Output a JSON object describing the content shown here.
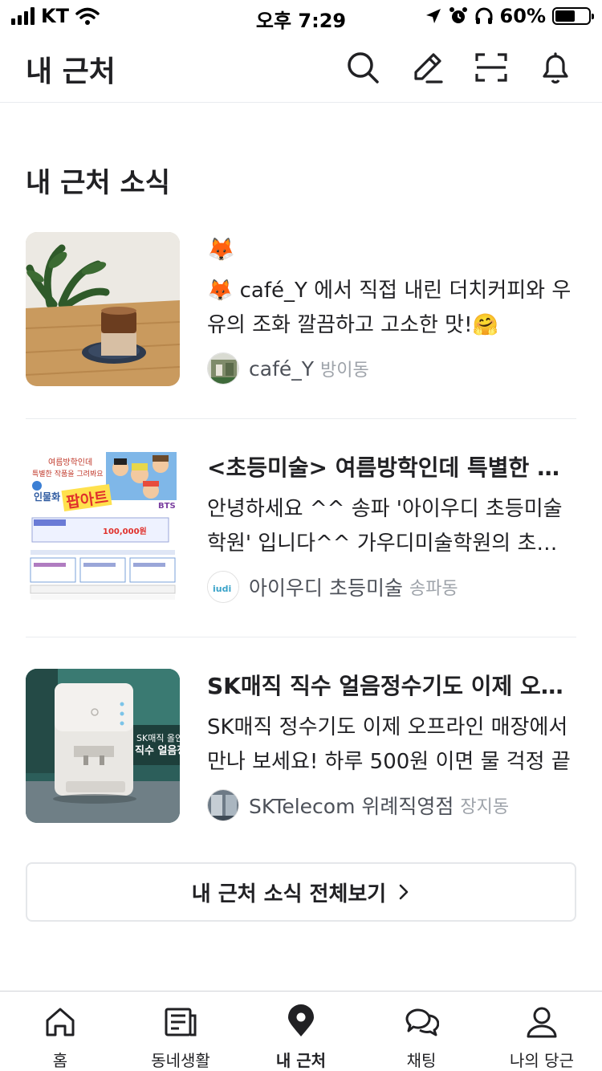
{
  "status_bar": {
    "carrier": "KT",
    "time": "오후 7:29",
    "battery": "60%",
    "battery_level": 0.6
  },
  "header": {
    "title": "내 근처",
    "icons": [
      "search-icon",
      "pencil-icon",
      "scan-icon",
      "bell-icon"
    ]
  },
  "section": {
    "title": "내 근처 소식"
  },
  "feed": [
    {
      "title": "🦊",
      "description": "🦊 café_Y 에서 직접 내린 더치커피와 우유의 조화 깔끔하고 고소한 맛!🤗",
      "business": "café_Y",
      "region": "방이동"
    },
    {
      "title": "<초등미술> 여름방학인데 특별한 작품을 그려봐요",
      "description": "안녕하세요 ^^ 송파 '아이우디 초등미술학원' 입니다^^ 가우디미술학원의 초등미술",
      "business": "아이우디 초등미술",
      "region": "송파동",
      "thumb_text": {
        "line1": "여름방학인데",
        "line2": "특별한 작품을 그려봐요",
        "badge": "인물화",
        "main": "팝아트",
        "price": "100,000원",
        "bts": "BTS"
      }
    },
    {
      "title": "SK매직 직수 얼음정수기도 이제 오프라인에서",
      "description": "SK매직 정수기도 이제 오프라인 매장에서 만나 보세요! 하루 500원 이면 물 걱정 끝",
      "business": "SKTelecom 위례직영점",
      "region": "장지동",
      "thumb_text": {
        "line1": "SK매직 올인원",
        "line2": "직수 얼음정"
      }
    }
  ],
  "see_all": {
    "label": "내 근처 소식 전체보기"
  },
  "bottom_nav": [
    {
      "label": "홈",
      "icon": "home-icon"
    },
    {
      "label": "동네생활",
      "icon": "document-icon"
    },
    {
      "label": "내 근처",
      "icon": "location-pin-icon",
      "active": true
    },
    {
      "label": "채팅",
      "icon": "chat-icon"
    },
    {
      "label": "나의 당근",
      "icon": "profile-icon"
    }
  ]
}
